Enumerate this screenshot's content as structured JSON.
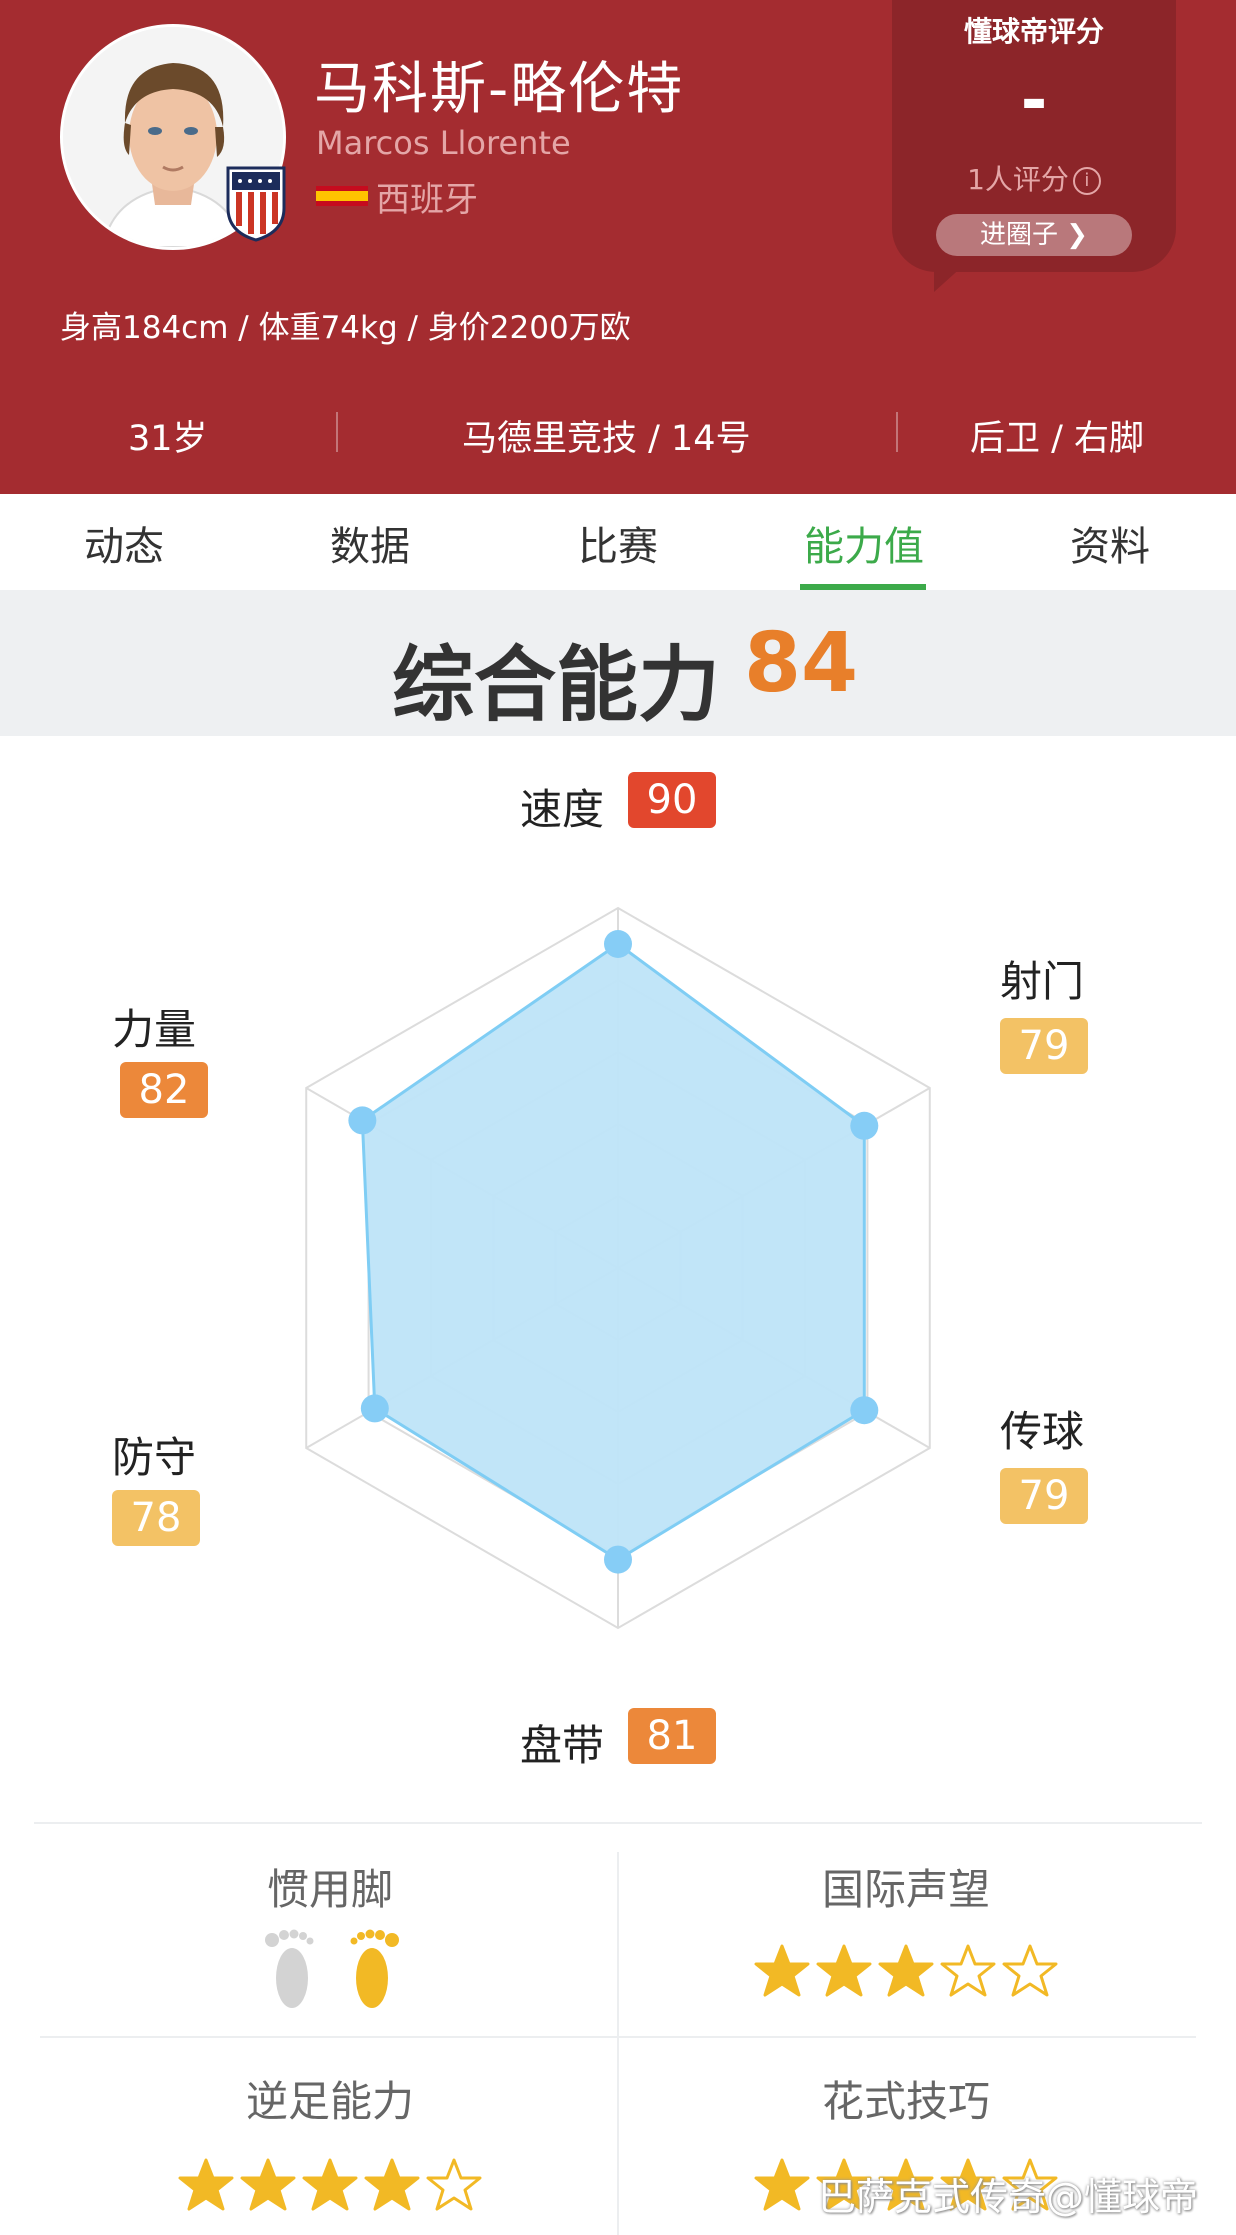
{
  "header": {
    "name_cn": "马科斯-略伦特",
    "name_en": "Marcos Llorente",
    "country": "西班牙",
    "body_info": "身高184cm / 体重74kg / 身价2200万欧",
    "age": "31岁",
    "club_number": "马德里竞技 / 14号",
    "position_foot": "后卫 / 右脚",
    "rating": {
      "title": "懂球帝评分",
      "score": "-",
      "count": "1人评分",
      "info_icon": "i",
      "button": "进圈子"
    }
  },
  "tabs": [
    {
      "label": "动态"
    },
    {
      "label": "数据"
    },
    {
      "label": "比赛"
    },
    {
      "label": "能力值",
      "active": true
    },
    {
      "label": "资料"
    }
  ],
  "overall": {
    "label": "综合能力",
    "value": "84"
  },
  "chart_data": {
    "type": "radar",
    "max": 100,
    "axes": [
      "速度",
      "射门",
      "传球",
      "盘带",
      "防守",
      "力量"
    ],
    "values": [
      90,
      79,
      79,
      81,
      78,
      82
    ],
    "value_colors": [
      "#e2472d",
      "#f3c265",
      "#f3c265",
      "#ec883a",
      "#f3c265",
      "#ec883a"
    ],
    "fill_color": "#bee4f8",
    "stroke_color": "#7fcdf4"
  },
  "attributes": {
    "speed": {
      "label": "速度",
      "value": "90"
    },
    "shooting": {
      "label": "射门",
      "value": "79"
    },
    "passing": {
      "label": "传球",
      "value": "79"
    },
    "dribbling": {
      "label": "盘带",
      "value": "81"
    },
    "defending": {
      "label": "防守",
      "value": "78"
    },
    "strength": {
      "label": "力量",
      "value": "82"
    }
  },
  "traits": {
    "preferred_foot": {
      "label": "惯用脚",
      "value": "右脚"
    },
    "reputation": {
      "label": "国际声望",
      "stars": 3,
      "max": 5
    },
    "weak_foot": {
      "label": "逆足能力",
      "stars": 4,
      "max": 5
    },
    "skill_moves": {
      "label": "花式技巧",
      "stars": 4,
      "max": 5
    }
  },
  "watermark": "巴萨克式传奇@懂球帝",
  "colors": {
    "header_bg": "#a42c30",
    "active_tab": "#3caa4a",
    "overall_value": "#e87f2a",
    "star": "#f2b925"
  }
}
